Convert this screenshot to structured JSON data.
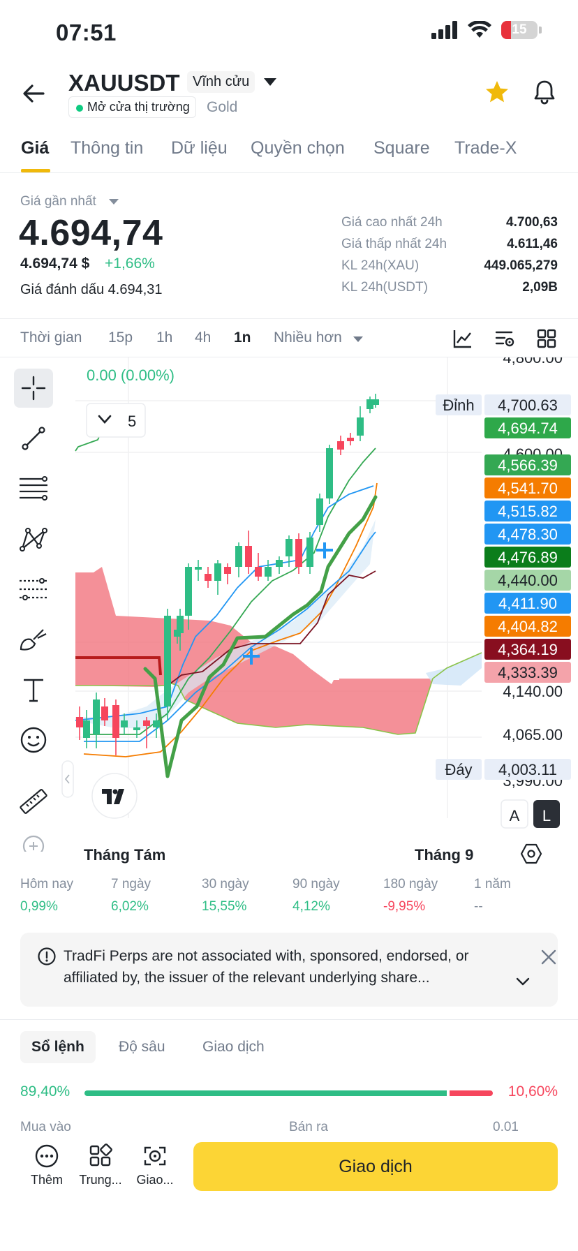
{
  "status_bar": {
    "time": "07:51",
    "battery": "15"
  },
  "header": {
    "symbol": "XAUUSDT",
    "contract_type": "Vĩnh cửu",
    "market_status": "Mở cửa thị trường",
    "category": "Gold"
  },
  "tabs": [
    {
      "label": "Giá",
      "active": true
    },
    {
      "label": "Thông tin"
    },
    {
      "label": "Dữ liệu"
    },
    {
      "label": "Quyền chọn"
    },
    {
      "label": "Square"
    },
    {
      "label": "Trade-X"
    }
  ],
  "price": {
    "last_label": "Giá gần nhất",
    "last": "4.694,74",
    "last_usd": "4.694,74 $",
    "change": "+1,66%",
    "mark_label": "Giá đánh dấu",
    "mark": "4.694,31"
  },
  "stats": [
    {
      "label": "Giá cao nhất 24h",
      "value": "4.700,63"
    },
    {
      "label": "Giá thấp nhất 24h",
      "value": "4.611,46"
    },
    {
      "label": "KL 24h(XAU)",
      "value": "449.065,279"
    },
    {
      "label": "KL 24h(USDT)",
      "value": "2,09B"
    }
  ],
  "intervals": [
    {
      "label": "Thời gian"
    },
    {
      "label": "15p"
    },
    {
      "label": "1h"
    },
    {
      "label": "4h"
    },
    {
      "label": "1n",
      "active": true
    },
    {
      "label": "Nhiều hơn"
    }
  ],
  "chart": {
    "change_text": "0.00 (0.00%)",
    "indicator_count": "5",
    "high_label": "Đỉnh",
    "low_label": "Đáy",
    "axis_ticks": [
      "4,800.00",
      "4,600.00",
      "4,140.00",
      "4,065.00",
      "3,990.00"
    ],
    "price_tags": [
      {
        "value": "4,700.63",
        "color": "#e8eef8",
        "text": "#1e2329",
        "label": "Đỉnh"
      },
      {
        "value": "4,694.74",
        "color": "#2ea84a",
        "text": "#ffffff"
      },
      {
        "value": "4,566.39",
        "color": "#34a853",
        "text": "#ffffff"
      },
      {
        "value": "4,541.70",
        "color": "#f57c00",
        "text": "#ffffff"
      },
      {
        "value": "4,515.82",
        "color": "#2196f3",
        "text": "#ffffff"
      },
      {
        "value": "4,478.30",
        "color": "#2196f3",
        "text": "#ffffff"
      },
      {
        "value": "4,476.89",
        "color": "#0b7d1b",
        "text": "#ffffff"
      },
      {
        "value": "4,440.00",
        "color": "#a5d6a7",
        "text": "#1e2329"
      },
      {
        "value": "4,411.90",
        "color": "#2196f3",
        "text": "#ffffff"
      },
      {
        "value": "4,404.82",
        "color": "#f57c00",
        "text": "#ffffff"
      },
      {
        "value": "4,364.19",
        "color": "#880e1f",
        "text": "#ffffff"
      },
      {
        "value": "4,333.39",
        "color": "#f4a3aa",
        "text": "#1e2329"
      },
      {
        "value": "4,003.11",
        "color": "#e8eef8",
        "text": "#1e2329",
        "label": "Đáy"
      }
    ],
    "months": [
      "Tháng Tám",
      "Tháng 9"
    ],
    "scale_buttons": [
      "A",
      "L"
    ]
  },
  "performance": [
    {
      "label": "Hôm nay",
      "value": "0,99%",
      "color": "#2ebd85"
    },
    {
      "label": "7 ngày",
      "value": "6,02%",
      "color": "#2ebd85"
    },
    {
      "label": "30 ngày",
      "value": "15,55%",
      "color": "#2ebd85"
    },
    {
      "label": "90 ngày",
      "value": "4,12%",
      "color": "#2ebd85"
    },
    {
      "label": "180 ngày",
      "value": "-9,95%",
      "color": "#f6465d"
    },
    {
      "label": "1 năm",
      "value": "--",
      "color": "#848e9c"
    }
  ],
  "notice": {
    "text": "TradFi Perps are not associated with, sponsored, endorsed, or affiliated by, the issuer of the relevant underlying share..."
  },
  "orderbook": {
    "tabs": [
      {
        "label": "Sổ lệnh",
        "active": true
      },
      {
        "label": "Độ sâu"
      },
      {
        "label": "Giao dịch"
      }
    ],
    "buy_pct": "89,40%",
    "sell_pct": "10,60%",
    "buy_fraction": 0.894,
    "peek_buy": "Mua vào",
    "peek_sell": "Bán ra",
    "peek_step": "0,01"
  },
  "bottom_bar": {
    "items": [
      {
        "label": "Thêm"
      },
      {
        "label": "Trung..."
      },
      {
        "label": "Giao..."
      }
    ],
    "trade_label": "Giao dịch"
  }
}
